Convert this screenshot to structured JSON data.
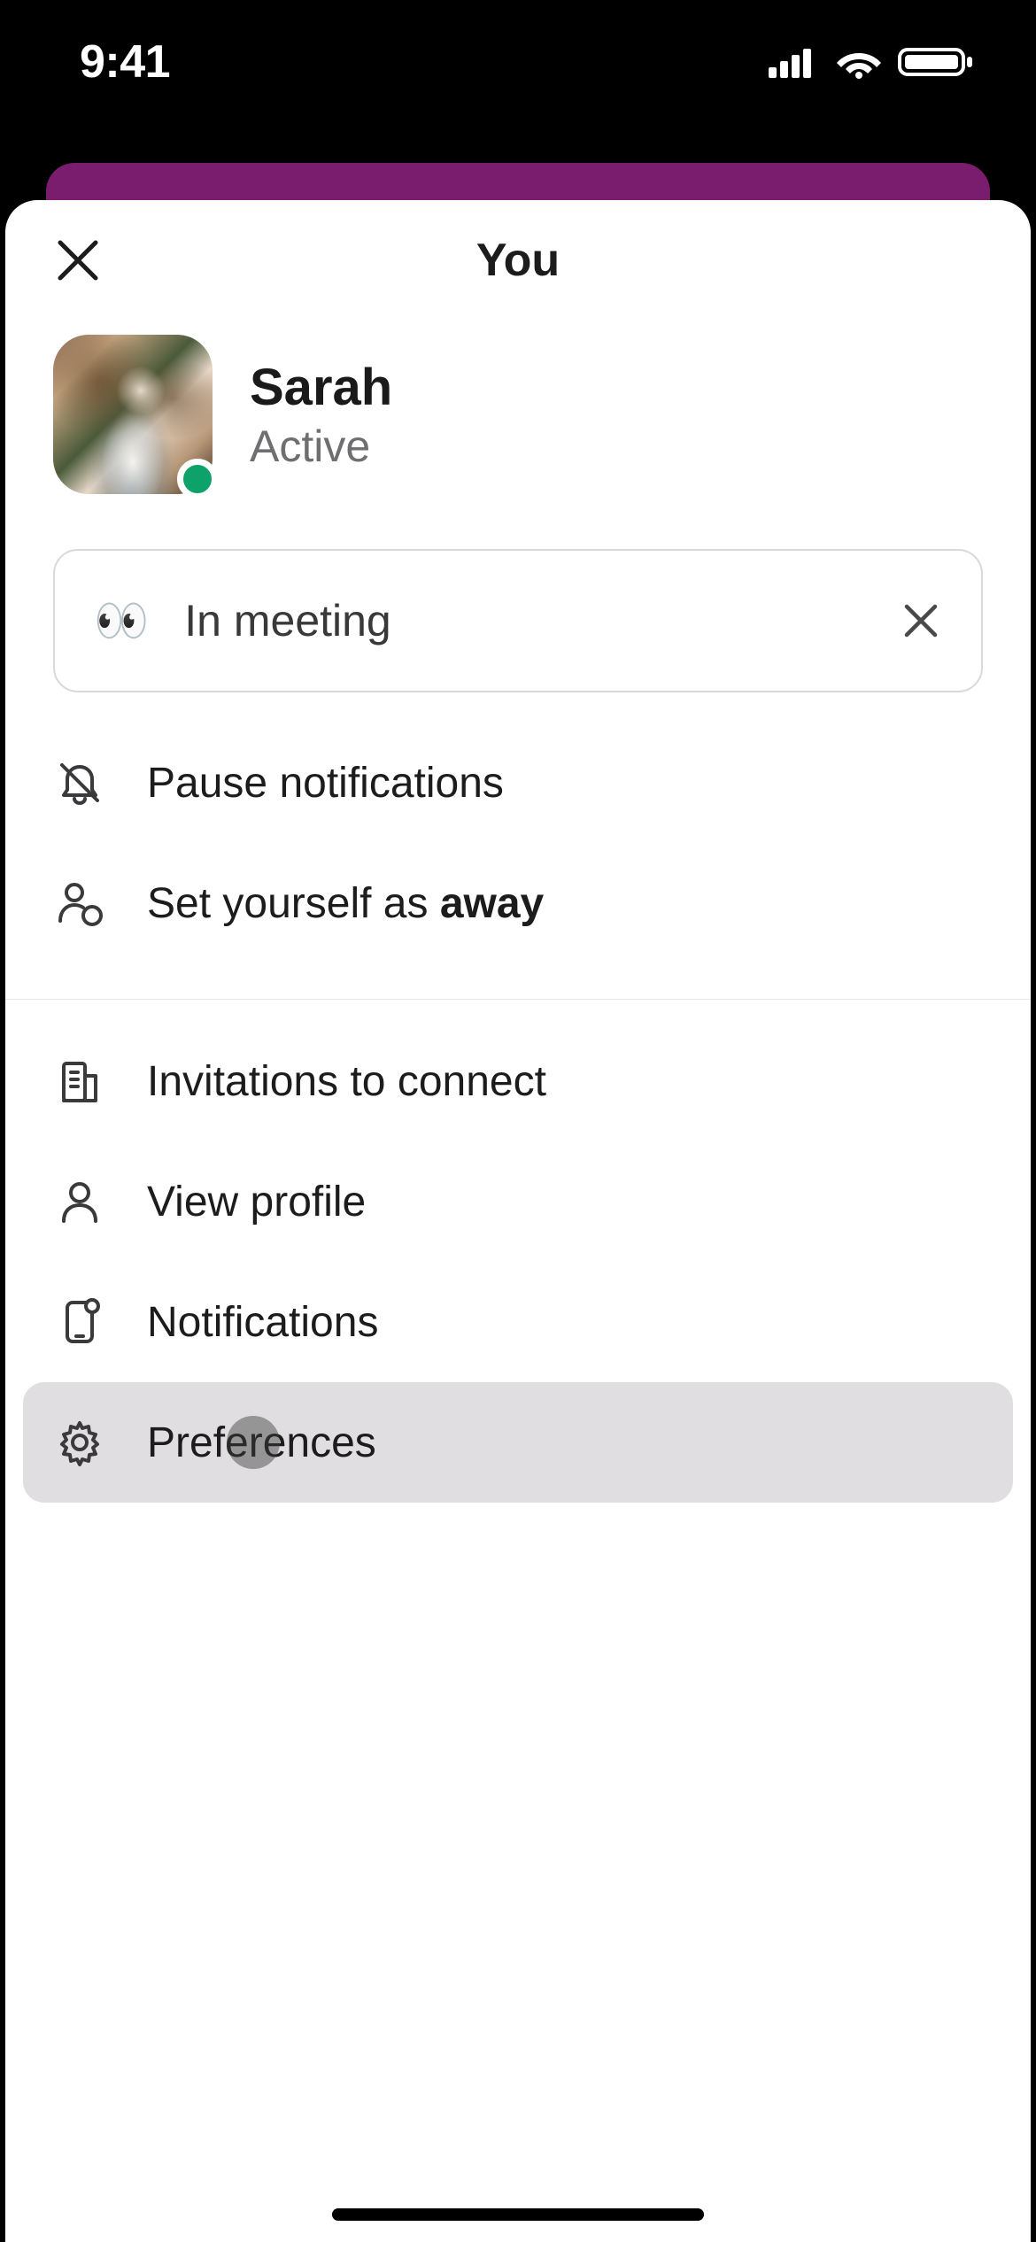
{
  "statusbar": {
    "time": "9:41"
  },
  "sheet": {
    "title": "You"
  },
  "profile": {
    "name": "Sarah",
    "presence": "Active"
  },
  "status": {
    "emoji": "👀",
    "text": "In meeting"
  },
  "menu": {
    "pause_notifications": "Pause notifications",
    "set_away_prefix": "Set yourself as ",
    "set_away_bold": "away",
    "invitations": "Invitations to connect",
    "view_profile": "View profile",
    "notifications": "Notifications",
    "preferences": "Preferences"
  }
}
